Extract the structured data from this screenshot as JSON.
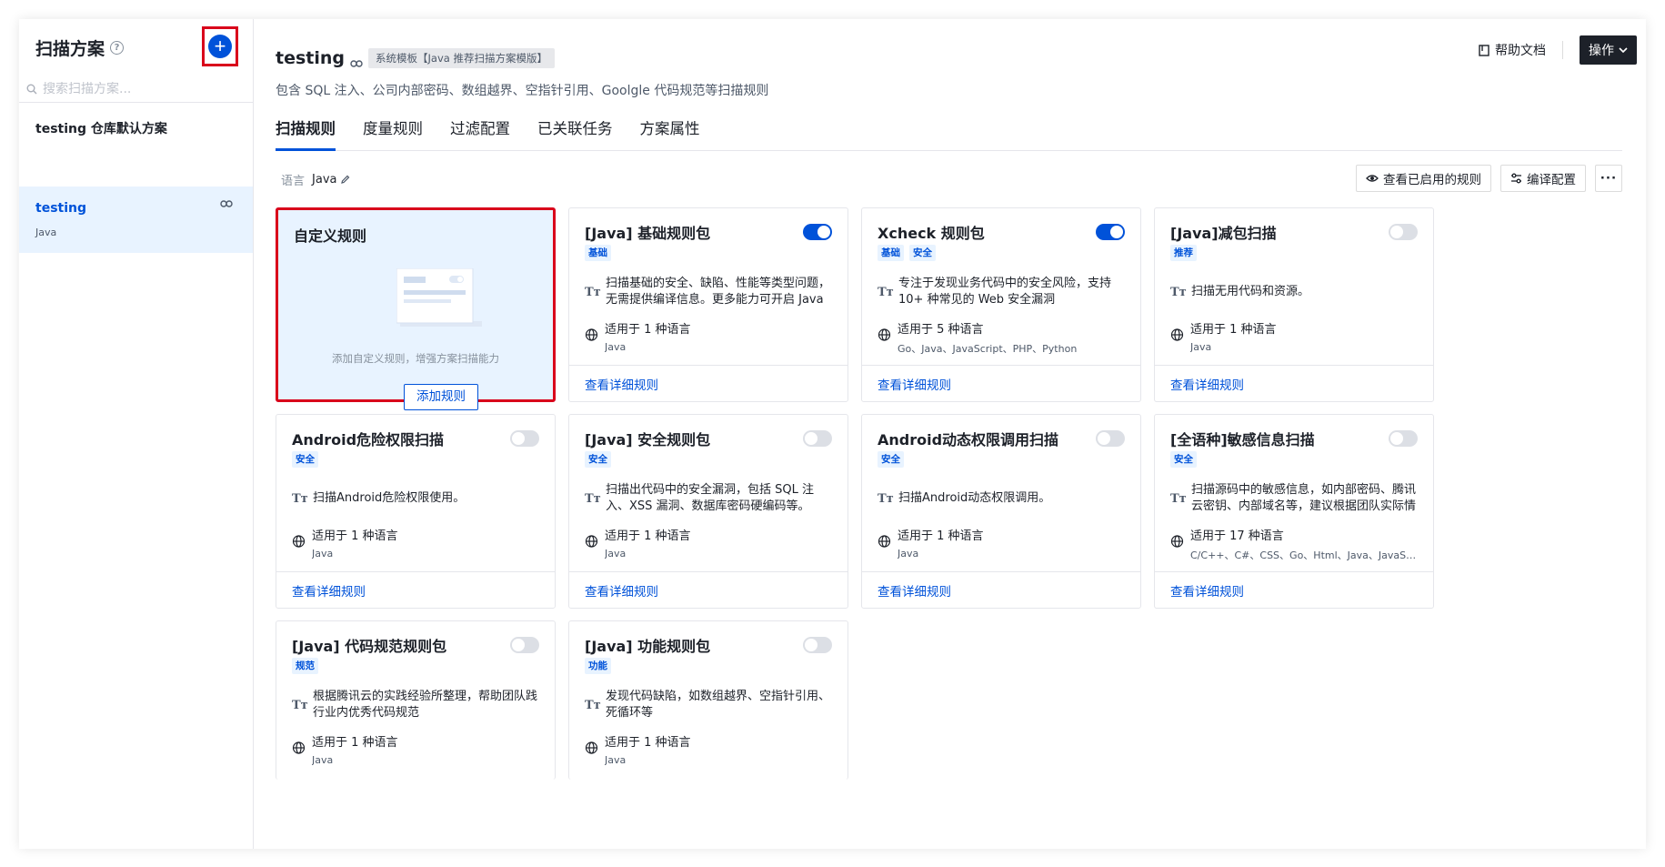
{
  "sidebar": {
    "title": "扫描方案",
    "search_placeholder": "搜索扫描方案...",
    "items": [
      {
        "name": "testing 仓库默认方案"
      },
      {
        "name": "testing",
        "sub": "Java"
      }
    ]
  },
  "header": {
    "title": "testing",
    "template_tag": "系统模板【Java 推荐扫描方案模版】",
    "description": "包含 SQL 注入、公司内部密码、数组越界、空指针引用、Goolgle 代码规范等扫描规则",
    "help_doc": "帮助文档",
    "operate": "操作"
  },
  "tabs": [
    "扫描规则",
    "度量规则",
    "过滤配置",
    "已关联任务",
    "方案属性"
  ],
  "toolbar": {
    "language_label": "语言",
    "language_value": "Java",
    "view_enabled": "查看已启用的规则",
    "compile_config": "编译配置",
    "more": "···"
  },
  "custom_card": {
    "title": "自定义规则",
    "text": "添加自定义规则，增强方案扫描能力",
    "button": "添加规则"
  },
  "cards": [
    {
      "title": "[Java] 基础规则包",
      "enabled": true,
      "tags": [
        "基础"
      ],
      "desc": "扫描基础的安全、缺陷、性能等类型问题，无需提供编译信息。更多能力可开启 Java 功能...",
      "lang_count": "适用于 1 种语言",
      "langs": "Java",
      "link": "查看详细规则"
    },
    {
      "title": "Xcheck 规则包",
      "enabled": true,
      "tags": [
        "基础",
        "安全"
      ],
      "desc": "专注于发现业务代码中的安全风险，支持 10+ 种常见的 Web 安全漏洞",
      "lang_count": "适用于 5 种语言",
      "langs": "Go、Java、JavaScript、PHP、Python",
      "link": "查看详细规则"
    },
    {
      "title": "[Java]减包扫描",
      "enabled": false,
      "tags": [
        "推荐"
      ],
      "desc": "扫描无用代码和资源。",
      "lang_count": "适用于 1 种语言",
      "langs": "Java",
      "link": "查看详细规则"
    },
    {
      "title": "Android危险权限扫描",
      "enabled": false,
      "tags": [
        "安全"
      ],
      "desc": "扫描Android危险权限使用。",
      "lang_count": "适用于 1 种语言",
      "langs": "Java",
      "link": "查看详细规则"
    },
    {
      "title": "[Java] 安全规则包",
      "enabled": false,
      "tags": [
        "安全"
      ],
      "desc": "扫描出代码中的安全漏洞，包括 SQL 注入、XSS 漏洞、数据库密码硬编码等。",
      "lang_count": "适用于 1 种语言",
      "langs": "Java",
      "link": "查看详细规则"
    },
    {
      "title": "Android动态权限调用扫描",
      "enabled": false,
      "tags": [
        "安全"
      ],
      "desc": "扫描Android动态权限调用。",
      "lang_count": "适用于 1 种语言",
      "langs": "Java",
      "link": "查看详细规则"
    },
    {
      "title": "[全语种]敏感信息扫描",
      "enabled": false,
      "tags": [
        "安全"
      ],
      "desc": "扫描源码中的敏感信息，如内部密码、腾讯云密钥、内部域名等，建议根据团队实际情况...",
      "lang_count": "适用于 17 种语言",
      "langs": "C/C++、C#、CSS、Go、Html、Java、JavaScript...",
      "link": "查看详细规则"
    },
    {
      "title": "[Java] 代码规范规则包",
      "enabled": false,
      "tags": [
        "规范"
      ],
      "desc": "根据腾讯云的实践经验所整理，帮助团队践行业内优秀代码规范",
      "lang_count": "适用于 1 种语言",
      "langs": "Java",
      "link": ""
    },
    {
      "title": "[Java] 功能规则包",
      "enabled": false,
      "tags": [
        "功能"
      ],
      "desc": "发现代码缺陷，如数组越界、空指针引用、死循环等",
      "lang_count": "适用于 1 种语言",
      "langs": "Java",
      "link": ""
    }
  ]
}
